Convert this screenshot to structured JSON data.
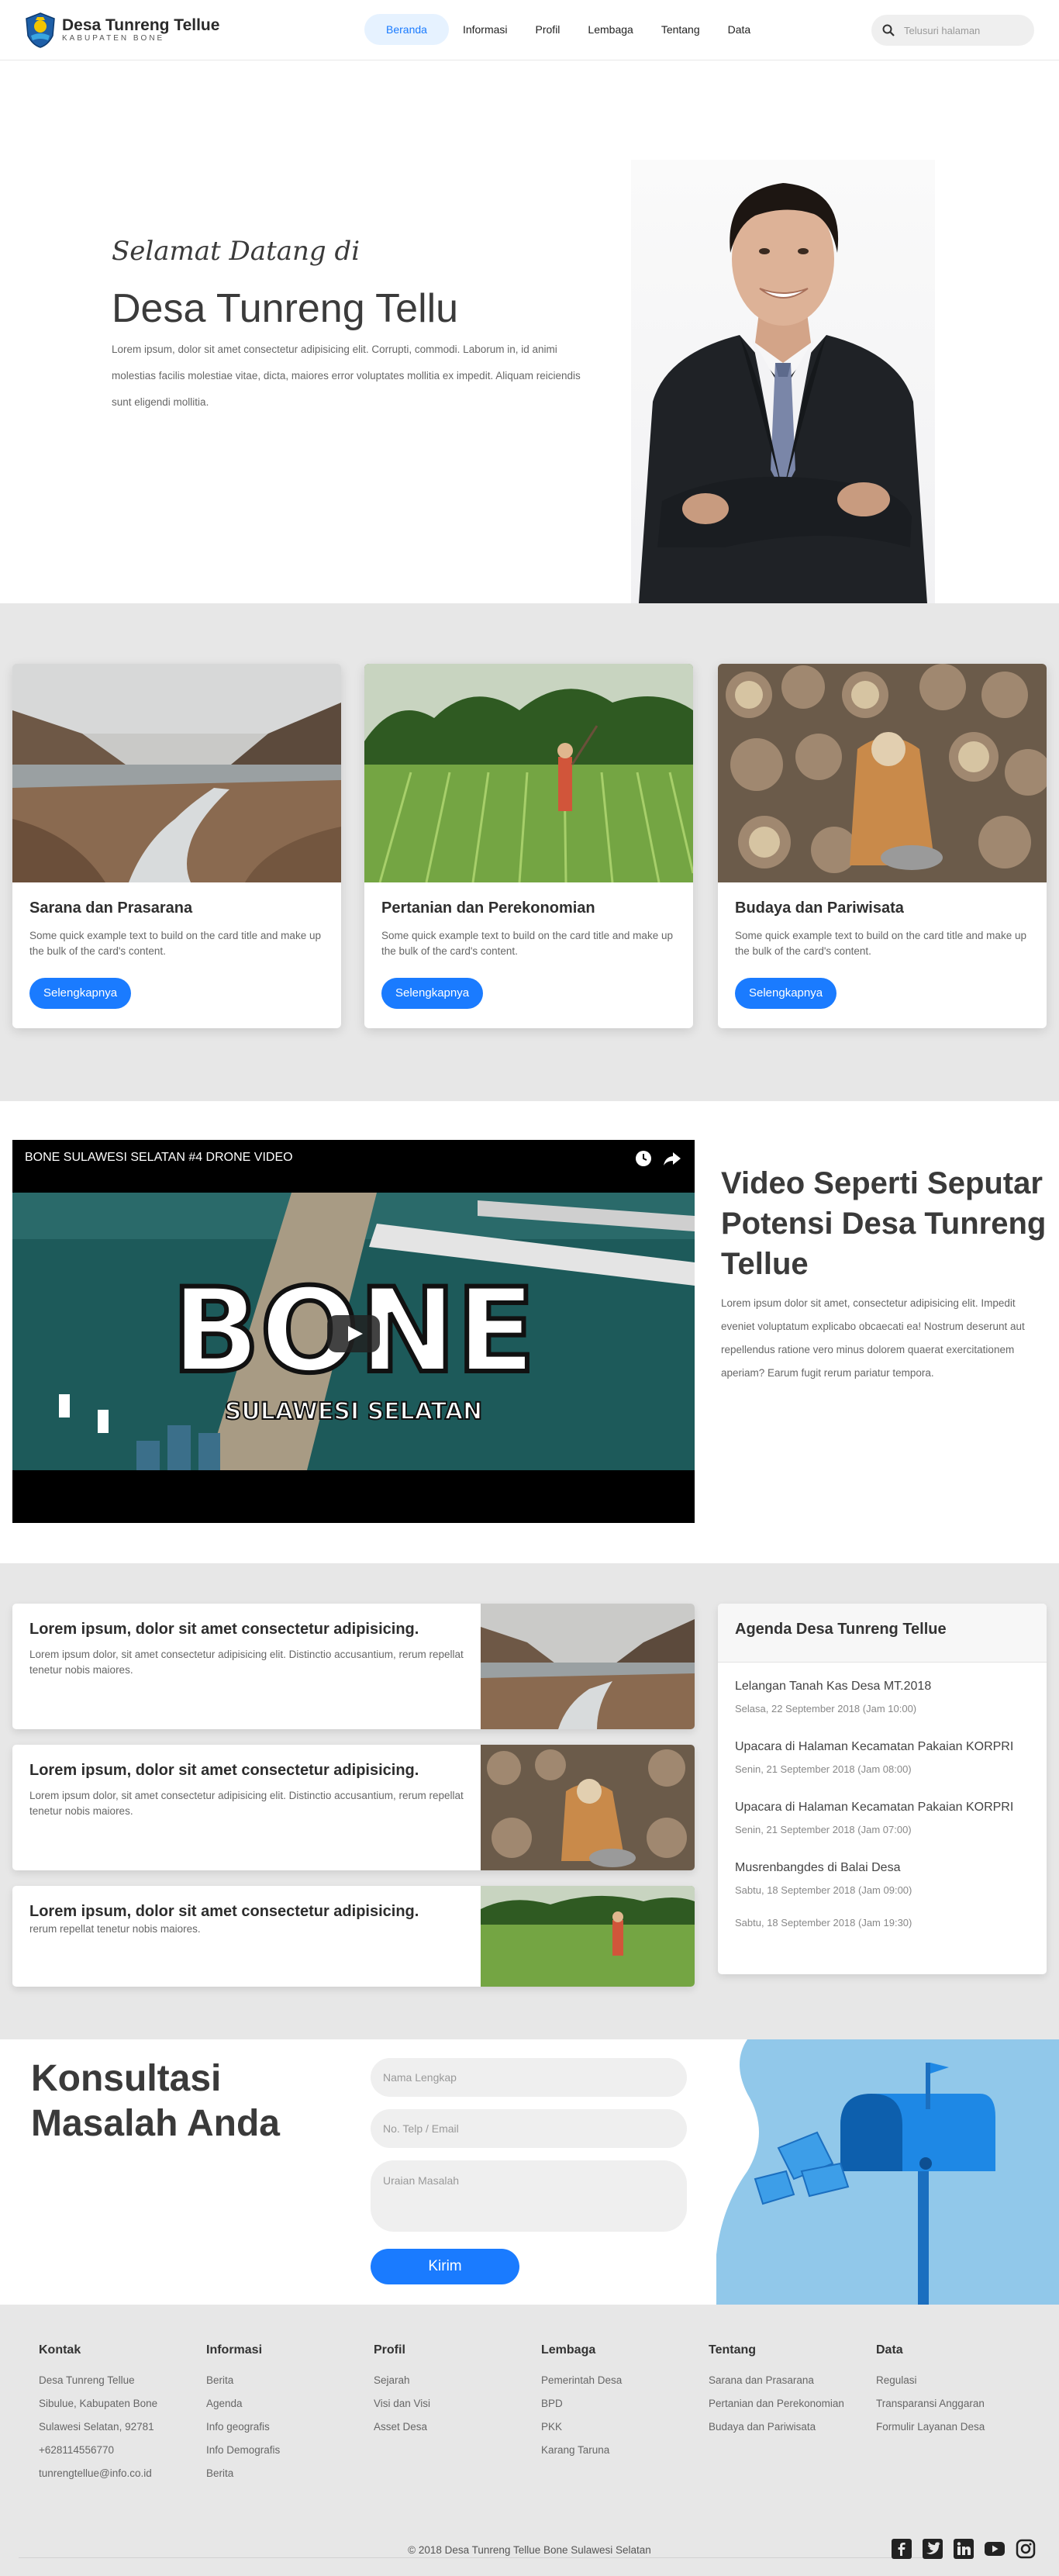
{
  "brand": {
    "name": "Desa Tunreng Tellue",
    "subtitle": "KABUPATEN BONE"
  },
  "nav": {
    "items": [
      {
        "label": "Beranda",
        "active": true
      },
      {
        "label": "Informasi",
        "active": false
      },
      {
        "label": "Profil",
        "active": false
      },
      {
        "label": "Lembaga",
        "active": false
      },
      {
        "label": "Tentang",
        "active": false
      },
      {
        "label": "Data",
        "active": false
      }
    ],
    "search_placeholder": "Telusuri halaman",
    "search_icon": "search-icon"
  },
  "hero": {
    "welcome": "Selamat Datang di",
    "title": "Desa Tunreng Tellu",
    "text": "Lorem ipsum, dolor sit amet consectetur adipisicing elit. Corrupti, commodi. Laborum in, id animi molestias facilis molestiae vitae, dicta, maiores error voluptates mollitia ex impedit. Aliquam reiciendis sunt eligendi mollitia."
  },
  "features": [
    {
      "title": "Sarana dan Prasarana",
      "text": "Some quick example text to build on the card title and make up the bulk of the card's content.",
      "button": "Selengkapnya"
    },
    {
      "title": "Pertanian dan Perekonomian",
      "text": "Some quick example text to build on the card title and make up the bulk of the card's content.",
      "button": "Selengkapnya"
    },
    {
      "title": "Budaya dan Pariwisata",
      "text": "Some quick example text to build on the card title and make up the bulk of the card's content.",
      "button": "Selengkapnya"
    }
  ],
  "video": {
    "title": "BONE SULAWESI SELATAN #4 DRONE VIDEO",
    "overlay_big": "BONE",
    "overlay_small": "SULAWESI SELATAN",
    "heading": "Video Seperti Seputar Potensi Desa Tunreng Tellue",
    "text": "Lorem ipsum dolor sit amet, consectetur adipisicing elit. Impedit eveniet voluptatum explicabo obcaecati ea! Nostrum deserunt aut repellendus ratione vero minus dolorem quaerat exercitationem aperiam? Earum fugit rerum pariatur tempora."
  },
  "news": [
    {
      "title": "Lorem ipsum, dolor sit amet consectetur adipisicing.",
      "text": "Lorem ipsum dolor, sit amet consectetur adipisicing elit. Distinctio accusantium, rerum repellat tenetur nobis maiores."
    },
    {
      "title": "Lorem ipsum, dolor sit amet consectetur adipisicing.",
      "text": "Lorem ipsum dolor, sit amet consectetur adipisicing elit. Distinctio accusantium, rerum repellat tenetur nobis maiores."
    },
    {
      "title": "Lorem ipsum, dolor sit amet consectetur adipisicing.",
      "text": "rerum repellat tenetur nobis maiores."
    }
  ],
  "agenda": {
    "title": "Agenda Desa Tunreng Tellue",
    "items": [
      {
        "title": "Lelangan Tanah Kas Desa MT.2018",
        "date": "Selasa, 22 September 2018 (Jam 10:00)"
      },
      {
        "title": "Upacara di Halaman Kecamatan Pakaian KORPRI",
        "date": "Senin, 21 September 2018 (Jam 08:00)"
      },
      {
        "title": "Upacara di Halaman Kecamatan Pakaian KORPRI",
        "date": "Senin, 21 September 2018 (Jam 07:00)"
      },
      {
        "title": "Musrenbangdes di Balai Desa",
        "date": "Sabtu, 18 September 2018 (Jam 09:00)"
      },
      {
        "title": "",
        "date": "Sabtu, 18 September 2018 (Jam 19:30)"
      }
    ]
  },
  "consult": {
    "title_line1": "Konsultasi",
    "title_line2": "Masalah Anda",
    "name_placeholder": "Nama Lengkap",
    "phone_placeholder": "No. Telp / Email",
    "issue_placeholder": "Uraian Masalah",
    "submit": "Kirim"
  },
  "footer": {
    "columns": [
      {
        "title": "Kontak",
        "items": [
          "Desa Tunreng Tellue",
          "Sibulue, Kabupaten Bone",
          "Sulawesi Selatan, 92781",
          "+628114556770",
          "tunrengtellue@info.co.id"
        ]
      },
      {
        "title": "Informasi",
        "items": [
          "Berita",
          "Agenda",
          "Info geografis",
          "Info Demografis",
          "Berita"
        ]
      },
      {
        "title": "Profil",
        "items": [
          "Sejarah",
          "Visi dan Visi",
          "Asset Desa"
        ]
      },
      {
        "title": "Lembaga",
        "items": [
          "Pemerintah Desa",
          "BPD",
          "PKK",
          "Karang Taruna"
        ]
      },
      {
        "title": "Tentang",
        "items": [
          "Sarana dan Prasarana",
          "Pertanian dan Perekonomian",
          "Budaya dan Pariwisata"
        ]
      },
      {
        "title": "Data",
        "items": [
          "Regulasi",
          "Transparansi Anggaran",
          "Formulir Layanan Desa"
        ]
      }
    ],
    "copyright": "© 2018 Desa Tunreng Tellue Bone Sulawesi Selatan",
    "social": [
      "facebook-icon",
      "twitter-icon",
      "linkedin-icon",
      "youtube-icon",
      "instagram-icon"
    ]
  },
  "colors": {
    "accent": "#1a7bff",
    "section_bg": "#e7e7e7",
    "text_dark": "#3a3a3a"
  }
}
